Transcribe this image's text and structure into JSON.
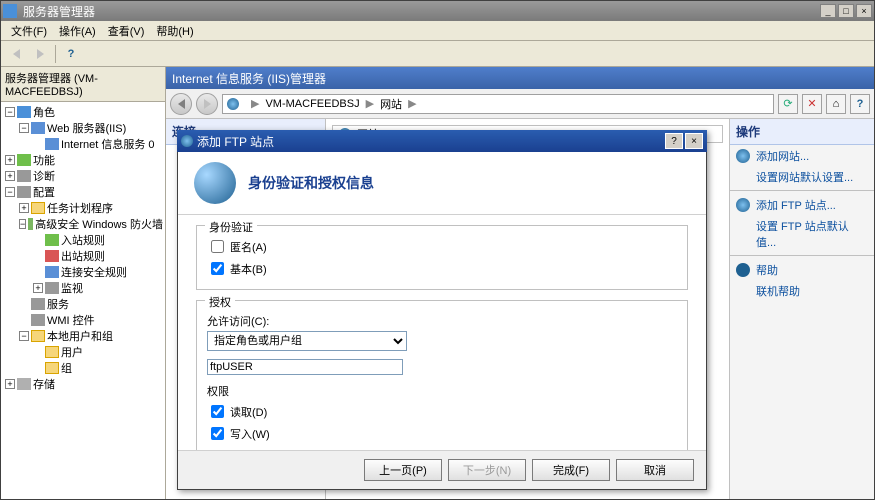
{
  "window": {
    "title": "服务器管理器",
    "min": "_",
    "max": "□",
    "close": "×"
  },
  "menu": {
    "file": "文件(F)",
    "action": "操作(A)",
    "view": "查看(V)",
    "help": "帮助(H)"
  },
  "tree": {
    "header": "服务器管理器 (VM-MACFEEDBSJ)",
    "roles": "角色",
    "web_server": "Web 服务器(IIS)",
    "iis_service": "Internet 信息服务 0",
    "features": "功能",
    "diagnostics": "诊断",
    "config": "配置",
    "task_scheduler": "任务计划程序",
    "firewall": "高级安全 Windows 防火墙",
    "inbound": "入站规则",
    "outbound": "出站规则",
    "conn_sec": "连接安全规则",
    "monitor": "监视",
    "services": "服务",
    "wmi": "WMI 控件",
    "local_users": "本地用户和组",
    "users": "用户",
    "groups": "组",
    "storage": "存储"
  },
  "iis": {
    "header_title": "Internet 信息服务 (IIS)管理器",
    "breadcrumb_host": "VM-MACFEEDBSJ",
    "breadcrumb_sites": "网站",
    "connections_title": "连接",
    "center_label": "网站",
    "actions_title": "操作",
    "action_add_site": "添加网站...",
    "action_site_defaults": "设置网站默认设置...",
    "action_add_ftp": "添加 FTP 站点...",
    "action_ftp_defaults": "设置 FTP 站点默认值...",
    "action_help": "帮助",
    "action_online_help": "联机帮助"
  },
  "dialog": {
    "title": "添加 FTP 站点",
    "heading": "身份验证和授权信息",
    "auth_group": "身份验证",
    "anonymous_label": "匿名(A)",
    "anonymous_checked": false,
    "basic_label": "基本(B)",
    "basic_checked": true,
    "authz_group": "授权",
    "allow_access_label": "允许访问(C):",
    "allow_access_value": "指定角色或用户组",
    "user_value": "ftpUSER",
    "perms_label": "权限",
    "read_label": "读取(D)",
    "read_checked": true,
    "write_label": "写入(W)",
    "write_checked": true,
    "btn_prev": "上一页(P)",
    "btn_next": "下一步(N)",
    "btn_finish": "完成(F)",
    "btn_cancel": "取消",
    "help_btn": "?",
    "close_btn": "×"
  }
}
